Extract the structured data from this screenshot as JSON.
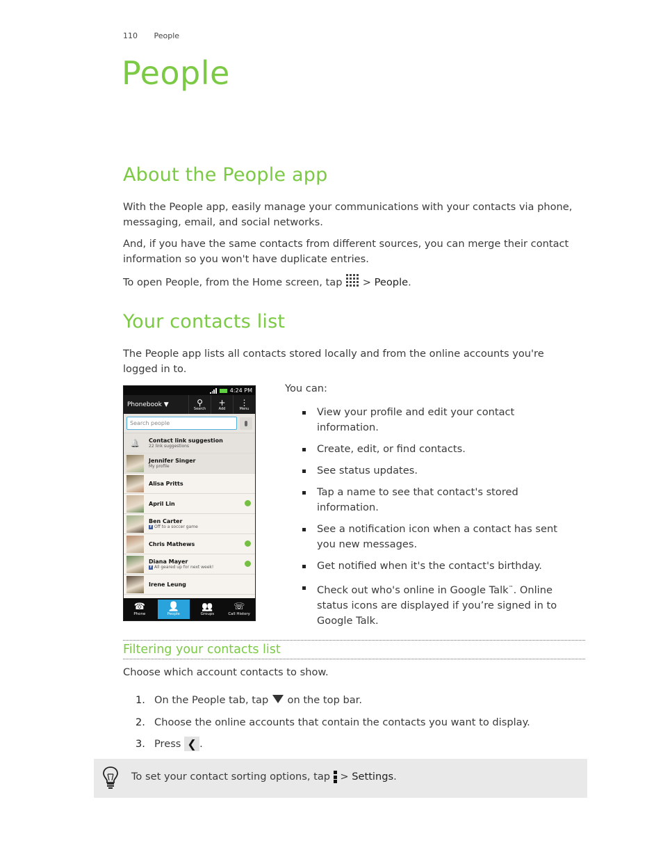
{
  "running_head": {
    "page_number": "110",
    "section": "People"
  },
  "chapter_title": "People",
  "about": {
    "heading": "About the People app",
    "para1": "With the People app, easily manage your communications with your contacts via phone, messaging, email, and social networks.",
    "para2": "And, if you have the same contacts from different sources, you can merge their contact information so you won't have duplicate entries.",
    "para3_before": "To open People, from the Home screen, tap",
    "para3_sep": ">",
    "para3_target": "People",
    "para3_after": ".",
    "apps_icon": "all-apps-grid-icon"
  },
  "contacts_list": {
    "heading": "Your contacts list",
    "intro": "The People app lists all contacts stored locally and from the online accounts you're logged in to.",
    "you_can": "You can:",
    "bullets": [
      "View your profile and edit your contact information.",
      "Create, edit, or find contacts.",
      "See status updates.",
      "Tap a name to see that contact's stored information.",
      "See a notification icon when a contact has sent you new messages.",
      "Get notified when it's the contact's birthday.",
      "Check out who's online in Google Talk"
    ],
    "bullet7_tm": "™",
    "bullet7_rest": ". Online status icons are displayed if you’re signed in to Google Talk."
  },
  "phone": {
    "status_time": "4:24 PM",
    "top_bar": {
      "title": "Phonebook",
      "buttons": [
        {
          "label": "Search",
          "icon": "search-icon"
        },
        {
          "label": "Add",
          "icon": "plus-icon"
        },
        {
          "label": "Menu",
          "icon": "menu-dots-icon"
        }
      ]
    },
    "search_placeholder": "Search people",
    "rows": [
      {
        "name": "Contact link suggestion",
        "sub": "22 link suggestions",
        "type": "suggestion",
        "online": false,
        "fb": false
      },
      {
        "name": "Jennifer Singer",
        "sub": "My profile",
        "type": "profile",
        "online": false,
        "fb": false
      },
      {
        "name": "Alisa Pritts",
        "sub": "",
        "type": "contact",
        "online": false,
        "fb": false
      },
      {
        "name": "April Lin",
        "sub": "",
        "type": "contact",
        "online": true,
        "fb": false
      },
      {
        "name": "Ben Carter",
        "sub": "Off to a soccer game",
        "type": "contact",
        "online": false,
        "fb": true
      },
      {
        "name": "Chris Mathews",
        "sub": "",
        "type": "contact",
        "online": true,
        "fb": false
      },
      {
        "name": "Diana Mayer",
        "sub": "All geared up for next week!",
        "type": "contact",
        "online": true,
        "fb": true
      },
      {
        "name": "Irene Leung",
        "sub": "",
        "type": "contact",
        "online": false,
        "fb": false
      }
    ],
    "bottom_tabs": [
      {
        "label": "Phone",
        "icon": "phone-icon",
        "active": false
      },
      {
        "label": "People",
        "icon": "person-icon",
        "active": true
      },
      {
        "label": "Groups",
        "icon": "groups-icon",
        "active": false
      },
      {
        "label": "Call History",
        "icon": "call-history-icon",
        "active": false
      }
    ]
  },
  "filtering": {
    "heading": "Filtering your contacts list",
    "intro": "Choose which account contacts to show.",
    "steps": [
      {
        "num": "1.",
        "before": "On the People tab, tap",
        "after": "on the top bar."
      },
      {
        "num": "2.",
        "before": "Choose the online accounts that contain the contacts you want to display.",
        "after": ""
      },
      {
        "num": "3.",
        "before": "Press",
        "after": "."
      }
    ]
  },
  "tip": {
    "before": "To set your contact sorting options, tap",
    "sep": ">",
    "target": "Settings",
    "after": "."
  },
  "colors": {
    "accent_green": "#7bc944",
    "body_text": "#3a3a3a",
    "tip_bg": "#e9e9e9",
    "phone_active_tab": "#2aa3dc",
    "online_dot": "#75c043"
  }
}
